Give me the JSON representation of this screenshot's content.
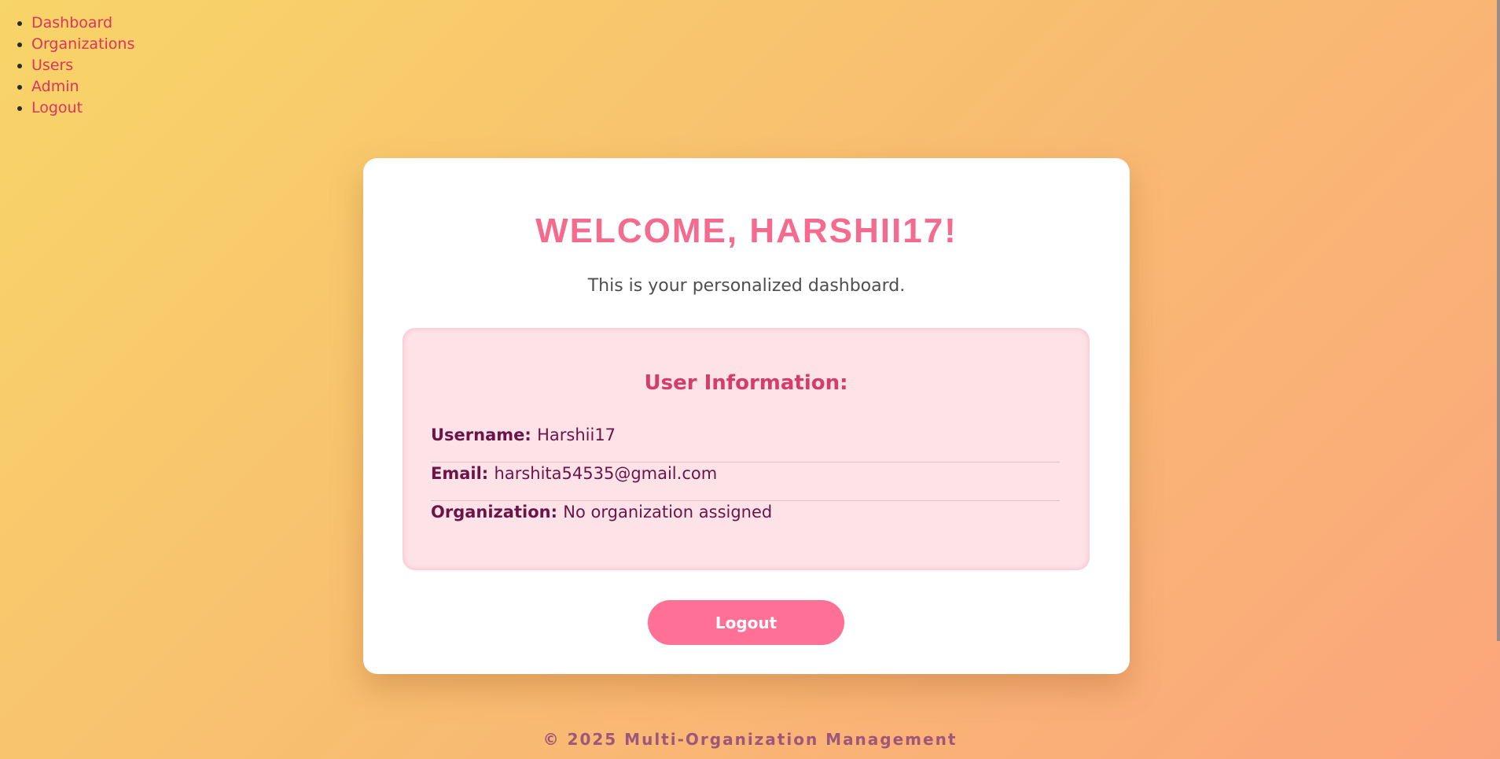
{
  "nav": {
    "items": [
      {
        "label": "Dashboard"
      },
      {
        "label": "Organizations"
      },
      {
        "label": "Users"
      },
      {
        "label": "Admin"
      },
      {
        "label": "Logout"
      }
    ]
  },
  "card": {
    "title": "WELCOME, HARSHII17!",
    "subtitle": "This is your personalized dashboard.",
    "info": {
      "heading": "User Information:",
      "rows": [
        {
          "label": "Username:",
          "value": "Harshii17"
        },
        {
          "label": "Email:",
          "value": "harshita54535@gmail.com"
        },
        {
          "label": "Organization:",
          "value": "No organization assigned"
        }
      ]
    },
    "logout_label": "Logout"
  },
  "footer": {
    "text": "© 2025 Multi-Organization Management"
  },
  "colors": {
    "accent": "#f46b8f",
    "link": "#e0325e",
    "info_background": "#fde3e8",
    "info_text": "#6b1447",
    "button": "#ff7096"
  }
}
